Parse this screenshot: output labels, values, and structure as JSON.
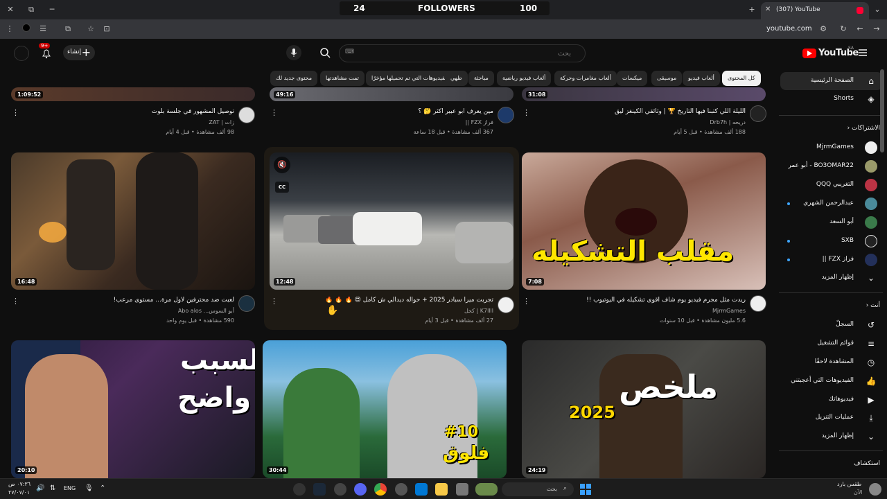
{
  "browser": {
    "tab_title": "(307) YouTube",
    "url": "youtube.com",
    "followers_left": "24",
    "followers_label": "FOLLOWERS",
    "followers_right": "100"
  },
  "header": {
    "logo_text": "YouTube",
    "logo_region": "SA",
    "search_placeholder": "بحث",
    "create_label": "إنشاء",
    "notification_count": "9+"
  },
  "chips": [
    "كل المحتوى",
    "ألعاب فيديو",
    "موسيقى",
    "ميكسات",
    "ألعاب مغامرات وحركة",
    "ألعاب فيديو رياضية",
    "مباحثة",
    "طهي",
    "الفيديوهات التي تم تحميلها مؤخرًا",
    "تمت مشاهدتها",
    "محتوى جديد لك"
  ],
  "sidebar": {
    "home": "الصفحة الرئيسية",
    "shorts": "Shorts",
    "subs_header": "الاشتراكات",
    "subs": [
      "MjrmGames",
      "BO3OMAR22 - أبو عمر",
      "التغريبي QQQ",
      "عبدالرحمن الشهري",
      "أبو السعد",
      "SXB",
      "فراز FZX ||"
    ],
    "show_more": "إظهار المزيد",
    "you_header": "أنت",
    "you_items": [
      "السجلّ",
      "قوائم التشغيل",
      "المشاهدة لاحقًا",
      "الفيديوهات التي أعجبتني",
      "فيديوهاتك",
      "عمليات التنزيل",
      "إظهار المزيد"
    ],
    "explore": "استكشاف"
  },
  "row0": [
    {
      "title": "الليلة اللي كتبنا فيها التاريخ 🏆 | وثائقي الكينغز ليق",
      "channel": "دريحه | Drb7h",
      "meta": "188 ألف مشاهدة • قبل 5 أيام",
      "duration": "31:08"
    },
    {
      "title": "مين يعرف ابو عبير اكثر 🤔 ؟",
      "channel": "فراز FZX ||",
      "meta": "367 ألف مشاهدة • قبل 18 ساعة",
      "duration": "49:16"
    },
    {
      "title": "توصيل المشهور في جلسة بلوت",
      "channel": "زات | ZAT",
      "meta": "98 ألف مشاهدة • قبل 4 أيام",
      "duration": "1:09:52"
    }
  ],
  "row1": [
    {
      "title": "ريدت مثل مجرم فيديو يوم شاف أقوى تشكيله في اليوتيوب !!",
      "channel": "MjrmGames",
      "meta": "5.6 مليون مشاهدة • قبل 10 سنوات",
      "duration": "7:08",
      "thumb_text": "مقلب التشكيله"
    },
    {
      "title": "تجربت ميرا سبادر 2025 + حواله ديدالي ش كامل 😍 🔥 🔥 🔥",
      "channel": "K7llll | كحل",
      "meta": "27 ألف مشاهدة • قبل 3 أيام",
      "duration": "12:48"
    },
    {
      "title": "لعبت ضد محترفين لأول مرة... مستوى مرعب!",
      "channel": "أبو السوس... Abo alos",
      "meta": "590 مشاهدة • قبل يوم واحد",
      "duration": "16:48"
    }
  ],
  "row2": [
    {
      "duration": "24:19",
      "thumb_text": "ملخص",
      "thumb_year": "2025"
    },
    {
      "duration": "30:44",
      "thumb_text": "فلوق",
      "thumb_num": "#10"
    },
    {
      "duration": "20:10",
      "thumb_text1": "لسبب",
      "thumb_text2": "واضح"
    }
  ],
  "taskbar": {
    "search": "بحث",
    "lang": "ENG",
    "time": "٠٧:٣٦ ص",
    "date": "٢٧/٠٧/٠١",
    "weather": "طقس بارد",
    "weather_sub": "الآن"
  }
}
